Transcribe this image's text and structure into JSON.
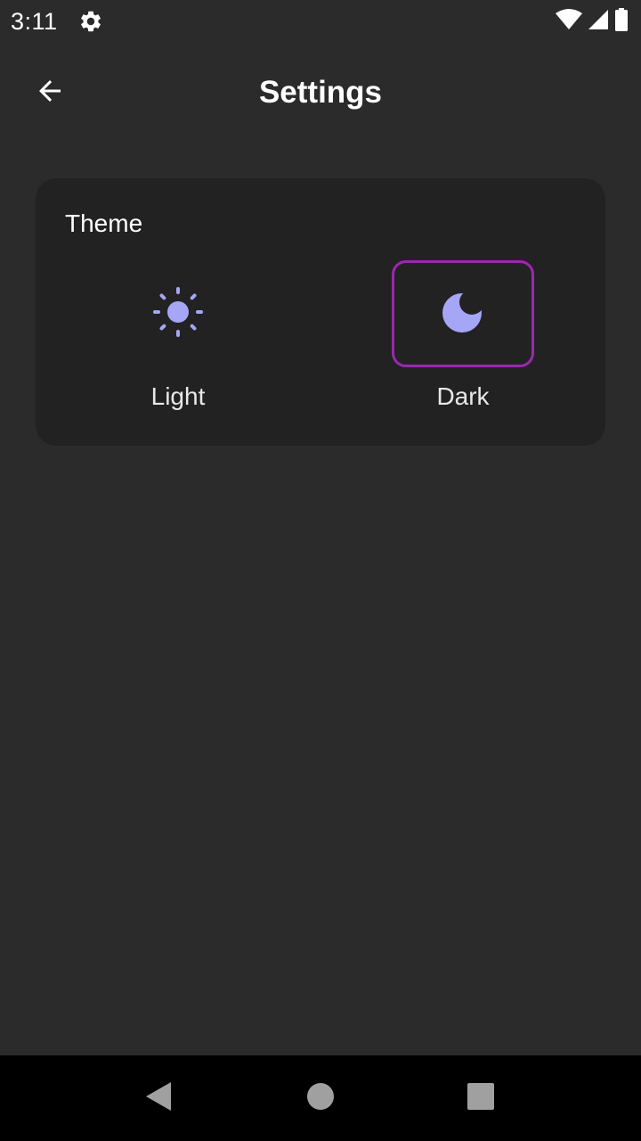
{
  "status_bar": {
    "time": "3:11",
    "icons": [
      "gear-icon",
      "wifi-icon",
      "cellular-signal-icon",
      "battery-icon"
    ]
  },
  "header": {
    "title": "Settings",
    "back_icon": "arrow-left-icon"
  },
  "theme_card": {
    "title": "Theme",
    "options": [
      {
        "label": "Light",
        "icon": "sun-icon",
        "selected": false
      },
      {
        "label": "Dark",
        "icon": "moon-icon",
        "selected": true
      }
    ]
  },
  "nav_bar": {
    "buttons": [
      "back-triangle-icon",
      "home-circle-icon",
      "recents-square-icon"
    ]
  },
  "colors": {
    "background": "#2b2b2b",
    "card": "#222222",
    "accent_icon": "#a5a6f6",
    "selected_border": "#9c27b0",
    "nav_bar": "#000000",
    "nav_icons": "#a0a0a0"
  }
}
